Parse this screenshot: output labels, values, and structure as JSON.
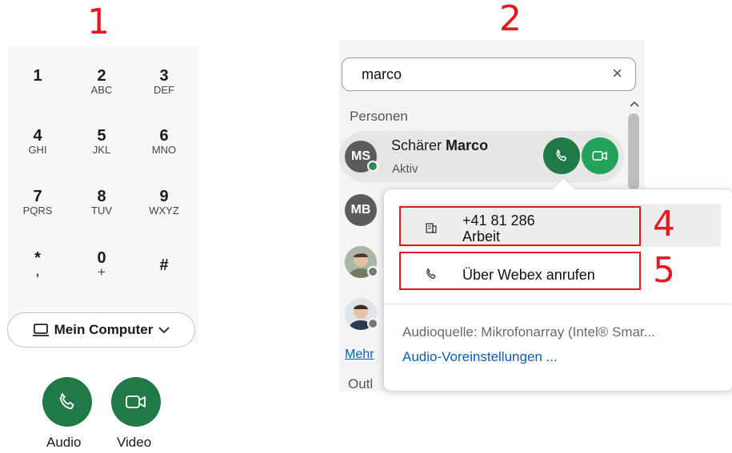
{
  "markers": [
    "1",
    "2",
    "4",
    "5"
  ],
  "dialpad": {
    "keys": [
      {
        "digit": "1",
        "letters": ""
      },
      {
        "digit": "2",
        "letters": "ABC"
      },
      {
        "digit": "3",
        "letters": "DEF"
      },
      {
        "digit": "4",
        "letters": "GHI"
      },
      {
        "digit": "5",
        "letters": "JKL"
      },
      {
        "digit": "6",
        "letters": "MNO"
      },
      {
        "digit": "7",
        "letters": "PQRS"
      },
      {
        "digit": "8",
        "letters": "TUV"
      },
      {
        "digit": "9",
        "letters": "WXYZ"
      },
      {
        "digit": "*",
        "letters": ","
      },
      {
        "digit": "0",
        "letters": "+"
      },
      {
        "digit": "#",
        "letters": ""
      }
    ],
    "device_label": "Mein Computer",
    "audio_label": "Audio",
    "video_label": "Video"
  },
  "search": {
    "value": "marco"
  },
  "sections": {
    "personen": "Personen",
    "mehr": "Mehr",
    "outlook": "Outl"
  },
  "contact": {
    "first": "Schärer",
    "last": "Marco",
    "status": "Aktiv",
    "initials": "MS"
  },
  "contact2": {
    "initials": "MB"
  },
  "popover": {
    "number": "+41 81 286",
    "number_type": "Arbeit",
    "webex_call": "Über Webex anrufen",
    "audio_source": "Audioquelle: Mikrofonarray (Intel® Smar...",
    "audio_settings": "Audio-Voreinstellungen ..."
  },
  "colors": {
    "accent_green": "#1f7a48",
    "marker_red": "#e8191c",
    "link_blue": "#0b5fb0"
  }
}
